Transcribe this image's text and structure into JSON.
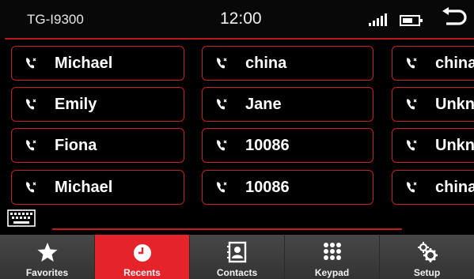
{
  "status": {
    "device_name": "TG-I9300",
    "time": "12:00",
    "icons": [
      "signal-icon",
      "battery-icon",
      "back-icon"
    ]
  },
  "recents": [
    {
      "name": "Michael",
      "icon": "phone-icon"
    },
    {
      "name": "china",
      "icon": "phone-icon"
    },
    {
      "name": "china r",
      "icon": "phone-icon"
    },
    {
      "name": "Emily",
      "icon": "phone-icon"
    },
    {
      "name": "Jane",
      "icon": "phone-icon"
    },
    {
      "name": "Unkno",
      "icon": "phone-icon"
    },
    {
      "name": "Fiona",
      "icon": "phone-icon"
    },
    {
      "name": "10086",
      "icon": "phone-icon"
    },
    {
      "name": "Unkno",
      "icon": "phone-icon"
    },
    {
      "name": "Michael",
      "icon": "phone-icon"
    },
    {
      "name": "10086",
      "icon": "phone-icon"
    },
    {
      "name": "china r",
      "icon": "phone-icon"
    }
  ],
  "tabs": [
    {
      "label": "Favorites",
      "icon": "star-icon",
      "active": false
    },
    {
      "label": "Recents",
      "icon": "clock-icon",
      "active": true
    },
    {
      "label": "Contacts",
      "icon": "contacts-book-icon",
      "active": false
    },
    {
      "label": "Keypad",
      "icon": "keypad-icon",
      "active": false
    },
    {
      "label": "Setup",
      "icon": "gears-icon",
      "active": false
    }
  ],
  "colors": {
    "accent": "#e5232b",
    "border": "#c52222",
    "background": "#000000",
    "tab_bar": "#3a3a3a"
  }
}
